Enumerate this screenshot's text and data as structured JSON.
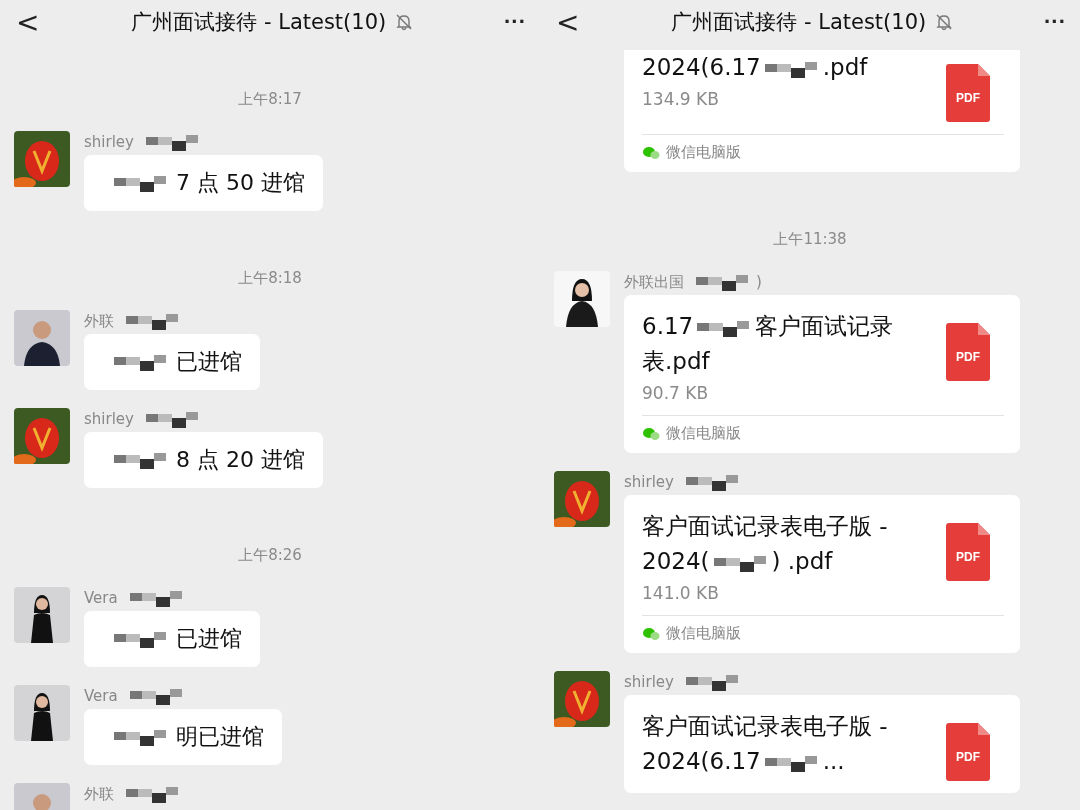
{
  "panels": [
    {
      "header": {
        "back": "<",
        "title": "广州面试接待 - Latest(10)",
        "muted": true,
        "more": "···"
      },
      "items": [
        {
          "kind": "time",
          "text": "上午8:17"
        },
        {
          "kind": "text",
          "avatar": {
            "kind": "tulip"
          },
          "sender": [
            {
              "kind": "text",
              "text": "shirley"
            },
            {
              "kind": "redaction"
            }
          ],
          "body": [
            {
              "kind": "redaction"
            },
            {
              "kind": "text",
              "text": "7 点 50 进馆"
            }
          ]
        },
        {
          "kind": "time",
          "text": "上午8:18"
        },
        {
          "kind": "text",
          "avatar": {
            "kind": "man"
          },
          "sender": [
            {
              "kind": "text",
              "text": "外联"
            },
            {
              "kind": "redaction"
            }
          ],
          "body": [
            {
              "kind": "redaction"
            },
            {
              "kind": "text",
              "text": "已进馆"
            }
          ]
        },
        {
          "kind": "text",
          "avatar": {
            "kind": "tulip"
          },
          "sender": [
            {
              "kind": "text",
              "text": "shirley"
            },
            {
              "kind": "redaction"
            }
          ],
          "body": [
            {
              "kind": "redaction"
            },
            {
              "kind": "text",
              "text": "8 点 20 进馆"
            }
          ]
        },
        {
          "kind": "time",
          "text": "上午8:26"
        },
        {
          "kind": "text",
          "avatar": {
            "kind": "woman"
          },
          "sender": [
            {
              "kind": "text",
              "text": "Vera"
            },
            {
              "kind": "redaction"
            }
          ],
          "body": [
            {
              "kind": "redaction"
            },
            {
              "kind": "text",
              "text": "已进馆"
            }
          ]
        },
        {
          "kind": "text",
          "avatar": {
            "kind": "woman"
          },
          "sender": [
            {
              "kind": "text",
              "text": "Vera"
            },
            {
              "kind": "redaction"
            }
          ],
          "body": [
            {
              "kind": "redaction"
            },
            {
              "kind": "text",
              "text": "明已进馆"
            }
          ]
        },
        {
          "kind": "stub",
          "avatar": {
            "kind": "man"
          },
          "sender": [
            {
              "kind": "text",
              "text": "外联"
            },
            {
              "kind": "redaction"
            }
          ]
        }
      ]
    },
    {
      "header": {
        "back": "<",
        "title": "广州面试接待 - Latest(10)",
        "muted": true,
        "more": "···"
      },
      "items": [
        {
          "kind": "file",
          "partial": true,
          "name": [
            {
              "kind": "text",
              "text": "2024(6.17"
            },
            {
              "kind": "redaction"
            },
            {
              "kind": "text",
              "text": ".pdf"
            }
          ],
          "size": "134.9 KB",
          "icon_label": "PDF",
          "source": "微信电脑版"
        },
        {
          "kind": "time",
          "text": "上午11:38"
        },
        {
          "kind": "file",
          "avatar": {
            "kind": "woman2"
          },
          "sender": [
            {
              "kind": "text",
              "text": "外联出国"
            },
            {
              "kind": "redaction"
            },
            {
              "kind": "text",
              "text": ")"
            }
          ],
          "name": [
            {
              "kind": "text",
              "text": "6.17"
            },
            {
              "kind": "redaction"
            },
            {
              "kind": "text",
              "text": "客户面试记录表.pdf"
            }
          ],
          "size": "90.7 KB",
          "icon_label": "PDF",
          "source": "微信电脑版"
        },
        {
          "kind": "file",
          "avatar": {
            "kind": "tulip"
          },
          "sender": [
            {
              "kind": "text",
              "text": "shirley"
            },
            {
              "kind": "redaction"
            }
          ],
          "name": [
            {
              "kind": "text",
              "text": "客户面试记录表电子版 - 2024("
            },
            {
              "kind": "redaction"
            },
            {
              "kind": "text",
              "text": ") .pdf"
            }
          ],
          "size": "141.0 KB",
          "icon_label": "PDF",
          "source": "微信电脑版"
        },
        {
          "kind": "file",
          "avatar": {
            "kind": "tulip"
          },
          "sender": [
            {
              "kind": "text",
              "text": "shirley"
            },
            {
              "kind": "redaction"
            }
          ],
          "name": [
            {
              "kind": "text",
              "text": "客户面试记录表电子版 - 2024(6.17"
            },
            {
              "kind": "redaction"
            },
            {
              "kind": "text",
              "text": "..."
            }
          ],
          "icon_label": "PDF"
        }
      ]
    }
  ]
}
